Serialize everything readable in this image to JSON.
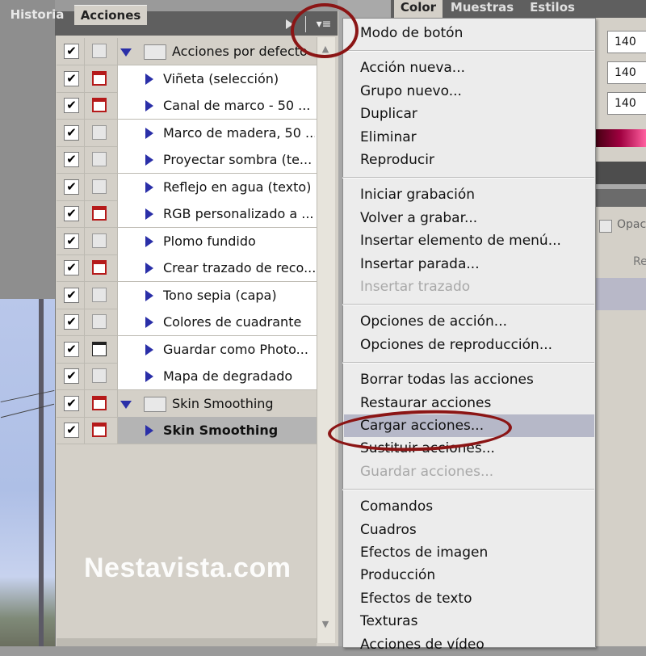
{
  "actions_panel": {
    "tabs": [
      "Historia",
      "Acciones"
    ],
    "rows": [
      {
        "type": "set",
        "label": "Acciones por defecto",
        "check": "✔",
        "dialog": "none"
      },
      {
        "type": "action",
        "label": "Viñeta (selección)",
        "check": "✔",
        "dialog": "red"
      },
      {
        "type": "action",
        "label": "Canal de marco - 50 ...",
        "check": "✔",
        "dialog": "red"
      },
      {
        "type": "action",
        "label": "Marco de madera, 50 ...",
        "check": "✔",
        "dialog": "none"
      },
      {
        "type": "action",
        "label": "Proyectar sombra (te...",
        "check": "✔",
        "dialog": "none"
      },
      {
        "type": "action",
        "label": "Reflejo en agua (texto)",
        "check": "✔",
        "dialog": "none"
      },
      {
        "type": "action",
        "label": "RGB personalizado a ...",
        "check": "✔",
        "dialog": "red"
      },
      {
        "type": "action",
        "label": "Plomo fundido",
        "check": "✔",
        "dialog": "none"
      },
      {
        "type": "action",
        "label": "Crear trazado de reco...",
        "check": "✔",
        "dialog": "red"
      },
      {
        "type": "action",
        "label": "Tono sepia (capa)",
        "check": "✔",
        "dialog": "none"
      },
      {
        "type": "action",
        "label": "Colores de cuadrante",
        "check": "✔",
        "dialog": "none"
      },
      {
        "type": "action",
        "label": "Guardar como Photo...",
        "check": "✔",
        "dialog": "black"
      },
      {
        "type": "action",
        "label": "Mapa de degradado",
        "check": "✔",
        "dialog": "none"
      },
      {
        "type": "set",
        "label": "Skin Smoothing",
        "check": "✔",
        "dialog": "red"
      },
      {
        "type": "action",
        "label": "Skin Smoothing",
        "check": "✔",
        "dialog": "red",
        "selected": true
      }
    ]
  },
  "right_panel": {
    "tabs": [
      "Color",
      "Muestras",
      "Estilos"
    ],
    "values": [
      "140",
      "140",
      "140"
    ],
    "opacity_label": "Opac",
    "re_label": "Re"
  },
  "flyout_menu": {
    "groups": [
      [
        {
          "label": "Modo de botón"
        }
      ],
      [
        {
          "label": "Acción nueva..."
        },
        {
          "label": "Grupo nuevo..."
        },
        {
          "label": "Duplicar"
        },
        {
          "label": "Eliminar"
        },
        {
          "label": "Reproducir"
        }
      ],
      [
        {
          "label": "Iniciar grabación"
        },
        {
          "label": "Volver a grabar..."
        },
        {
          "label": "Insertar elemento de menú..."
        },
        {
          "label": "Insertar parada..."
        },
        {
          "label": "Insertar trazado",
          "disabled": true
        }
      ],
      [
        {
          "label": "Opciones de acción..."
        },
        {
          "label": "Opciones de reproducción..."
        }
      ],
      [
        {
          "label": "Borrar todas las acciones"
        },
        {
          "label": "Restaurar acciones"
        },
        {
          "label": "Cargar acciones...",
          "highlighted": true
        },
        {
          "label": "Sustituir acciones..."
        },
        {
          "label": "Guardar acciones...",
          "disabled": true
        }
      ],
      [
        {
          "label": "Comandos"
        },
        {
          "label": "Cuadros"
        },
        {
          "label": "Efectos de imagen"
        },
        {
          "label": "Producción"
        },
        {
          "label": "Efectos de texto"
        },
        {
          "label": "Texturas"
        },
        {
          "label": "Acciones de vídeo"
        }
      ]
    ]
  },
  "watermark": "Nestavista.com",
  "colors": {
    "annotation": "#8b1515",
    "menu_highlight": "#b6b8c8",
    "action_triangle": "#2a2fa8",
    "dialog_red": "#b51a1a"
  }
}
